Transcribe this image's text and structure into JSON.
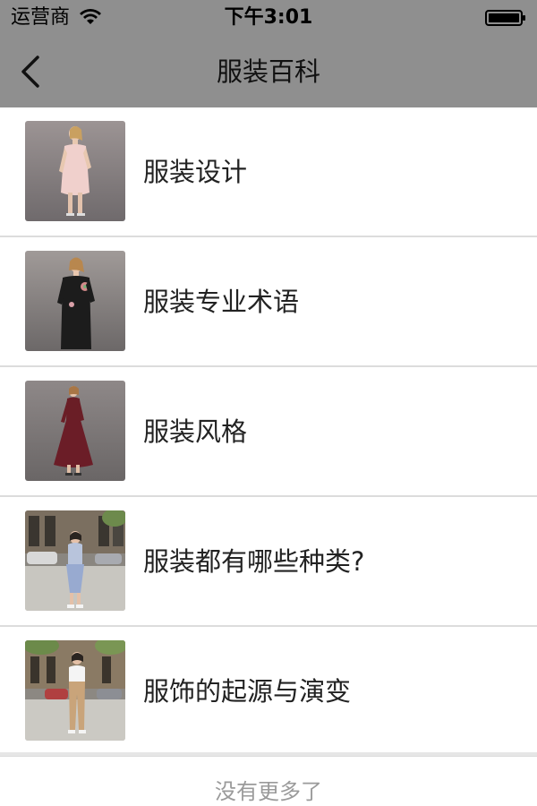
{
  "status_bar": {
    "carrier": "运营商",
    "time": "下午3:01",
    "wifi_icon": "wifi-icon",
    "battery_icon": "battery-icon"
  },
  "nav": {
    "title": "服装百科",
    "back_icon": "chevron-left-icon"
  },
  "items": [
    {
      "label": "服装设计",
      "thumb": "model-in-pink-dress-photo"
    },
    {
      "label": "服装专业术语",
      "thumb": "model-in-black-dress-photo"
    },
    {
      "label": "服装风格",
      "thumb": "model-in-burgundy-long-dress-photo"
    },
    {
      "label": "服装都有哪些种类?",
      "thumb": "model-on-street-in-blue-skirt-photo"
    },
    {
      "label": "服饰的起源与演变",
      "thumb": "model-on-street-in-khaki-pants-photo"
    }
  ],
  "footer": {
    "no_more_text": "没有更多了"
  },
  "colors": {
    "bar_background": "#8f8f8f",
    "divider": "#dcdcdc",
    "footer_text": "#9a9a9a"
  }
}
